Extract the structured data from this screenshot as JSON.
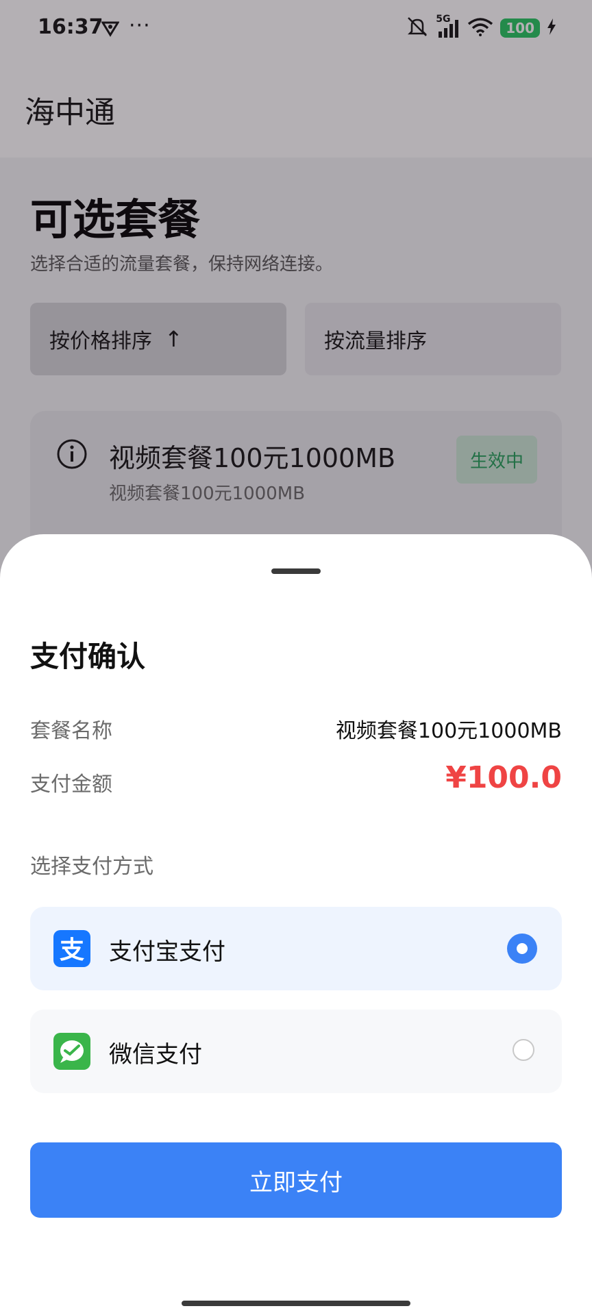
{
  "status_bar": {
    "time": "16:37",
    "dots": "···",
    "network": "5G",
    "battery": "100",
    "icons": [
      "vpn-icon",
      "mute-icon",
      "signal-icon",
      "wifi-icon",
      "charging-icon"
    ]
  },
  "app": {
    "title": "海中通"
  },
  "page": {
    "heading": "可选套餐",
    "subtitle": "选择合适的流量套餐，保持网络连接。",
    "sort": {
      "price_label": "按价格排序",
      "price_arrow": "↑",
      "flow_label": "按流量排序"
    },
    "package": {
      "title": "视频套餐100元1000MB",
      "subtitle": "视频套餐100元1000MB",
      "status": "生效中"
    }
  },
  "sheet": {
    "title": "支付确认",
    "package_name_label": "套餐名称",
    "package_name_value": "视频套餐100元1000MB",
    "amount_label": "支付金额",
    "amount_value": "¥100.0",
    "method_label": "选择支付方式",
    "methods": [
      {
        "label": "支付宝支付",
        "icon": "alipay-icon",
        "selected": true
      },
      {
        "label": "微信支付",
        "icon": "wechat-pay-icon",
        "selected": false
      }
    ],
    "pay_button": "立即支付"
  },
  "colors": {
    "primary": "#3b82f6",
    "amount": "#ef4444",
    "active_badge_bg": "#c9e7d4",
    "active_badge_text": "#1f9d57",
    "alipay": "#1677ff",
    "wechat": "#3ab54a"
  }
}
